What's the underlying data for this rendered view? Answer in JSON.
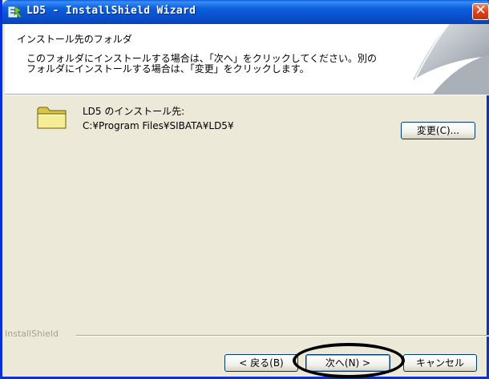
{
  "window": {
    "title": "LD5 - InstallShield Wizard",
    "close_glyph": "✕"
  },
  "header": {
    "title": "インストール先のフォルダ",
    "description_line1": "このフォルダにインストールする場合は、「次へ」をクリックしてください。別の",
    "description_line2": "フォルダにインストールする場合は、「変更」をクリックします。"
  },
  "main": {
    "folder_label": "LD5 のインストール先:",
    "folder_path": "C:¥Program Files¥SIBATA¥LD5¥",
    "change_button": "変更(C)..."
  },
  "footer": {
    "brand": "InstallShield",
    "back_button": "< 戻る(B)",
    "next_button": "次へ(N) >",
    "cancel_button": "キャンセル"
  },
  "colors": {
    "titlebar": "#0a5fdb",
    "dialog_bg": "#ece9d8",
    "close_button": "#d8451e",
    "highlight": "#000000"
  },
  "icons": {
    "title": "installer-icon",
    "folder": "folder-icon",
    "close": "close-icon"
  }
}
